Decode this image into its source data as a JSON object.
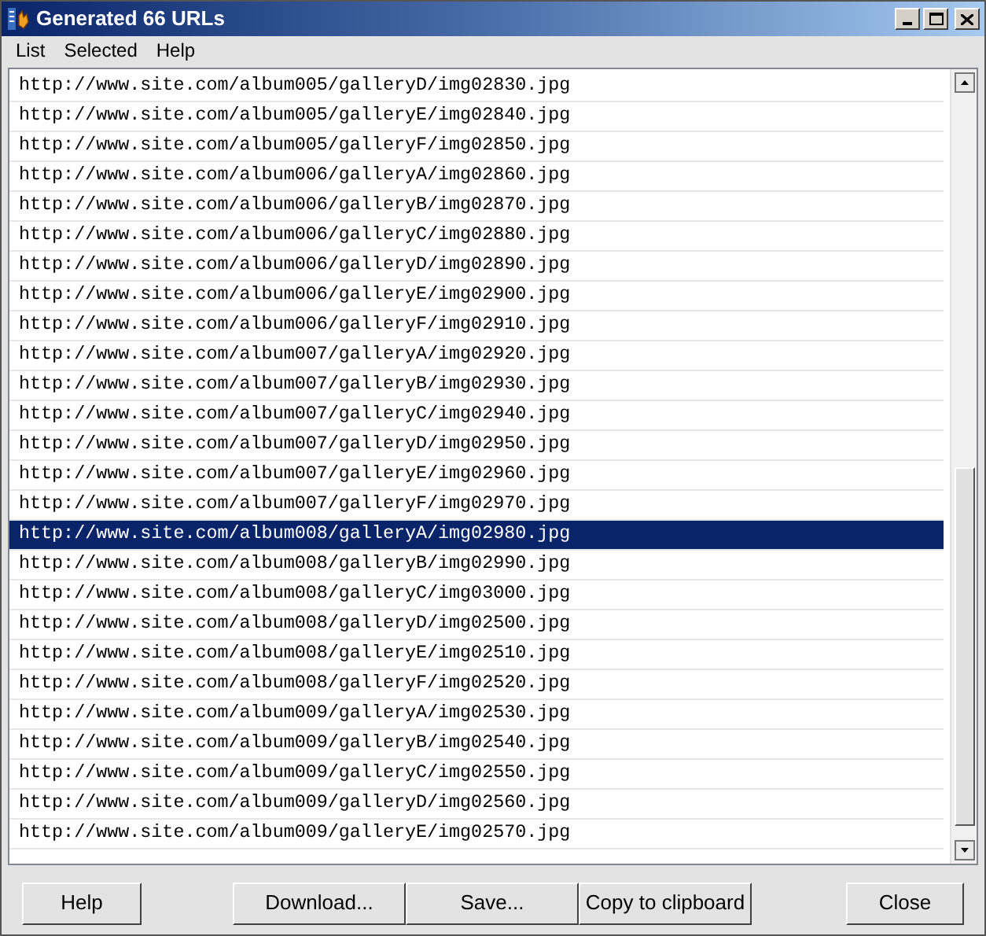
{
  "window": {
    "title": "Generated 66 URLs"
  },
  "menu": [
    "List",
    "Selected",
    "Help"
  ],
  "list": {
    "rows": [
      {
        "url": "http://www.site.com/album005/galleryD/img02830.jpg",
        "selected": false
      },
      {
        "url": "http://www.site.com/album005/galleryE/img02840.jpg",
        "selected": false
      },
      {
        "url": "http://www.site.com/album005/galleryF/img02850.jpg",
        "selected": false
      },
      {
        "url": "http://www.site.com/album006/galleryA/img02860.jpg",
        "selected": false
      },
      {
        "url": "http://www.site.com/album006/galleryB/img02870.jpg",
        "selected": false
      },
      {
        "url": "http://www.site.com/album006/galleryC/img02880.jpg",
        "selected": false
      },
      {
        "url": "http://www.site.com/album006/galleryD/img02890.jpg",
        "selected": false
      },
      {
        "url": "http://www.site.com/album006/galleryE/img02900.jpg",
        "selected": false
      },
      {
        "url": "http://www.site.com/album006/galleryF/img02910.jpg",
        "selected": false
      },
      {
        "url": "http://www.site.com/album007/galleryA/img02920.jpg",
        "selected": false
      },
      {
        "url": "http://www.site.com/album007/galleryB/img02930.jpg",
        "selected": false
      },
      {
        "url": "http://www.site.com/album007/galleryC/img02940.jpg",
        "selected": false
      },
      {
        "url": "http://www.site.com/album007/galleryD/img02950.jpg",
        "selected": false
      },
      {
        "url": "http://www.site.com/album007/galleryE/img02960.jpg",
        "selected": false
      },
      {
        "url": "http://www.site.com/album007/galleryF/img02970.jpg",
        "selected": false
      },
      {
        "url": "http://www.site.com/album008/galleryA/img02980.jpg",
        "selected": true
      },
      {
        "url": "http://www.site.com/album008/galleryB/img02990.jpg",
        "selected": false
      },
      {
        "url": "http://www.site.com/album008/galleryC/img03000.jpg",
        "selected": false
      },
      {
        "url": "http://www.site.com/album008/galleryD/img02500.jpg",
        "selected": false
      },
      {
        "url": "http://www.site.com/album008/galleryE/img02510.jpg",
        "selected": false
      },
      {
        "url": "http://www.site.com/album008/galleryF/img02520.jpg",
        "selected": false
      },
      {
        "url": "http://www.site.com/album009/galleryA/img02530.jpg",
        "selected": false
      },
      {
        "url": "http://www.site.com/album009/galleryB/img02540.jpg",
        "selected": false
      },
      {
        "url": "http://www.site.com/album009/galleryC/img02550.jpg",
        "selected": false
      },
      {
        "url": "http://www.site.com/album009/galleryD/img02560.jpg",
        "selected": false
      },
      {
        "url": "http://www.site.com/album009/galleryE/img02570.jpg",
        "selected": false
      }
    ]
  },
  "buttons": [
    "Help",
    "Download...",
    "Save...",
    "Copy to clipboard",
    "Close"
  ]
}
